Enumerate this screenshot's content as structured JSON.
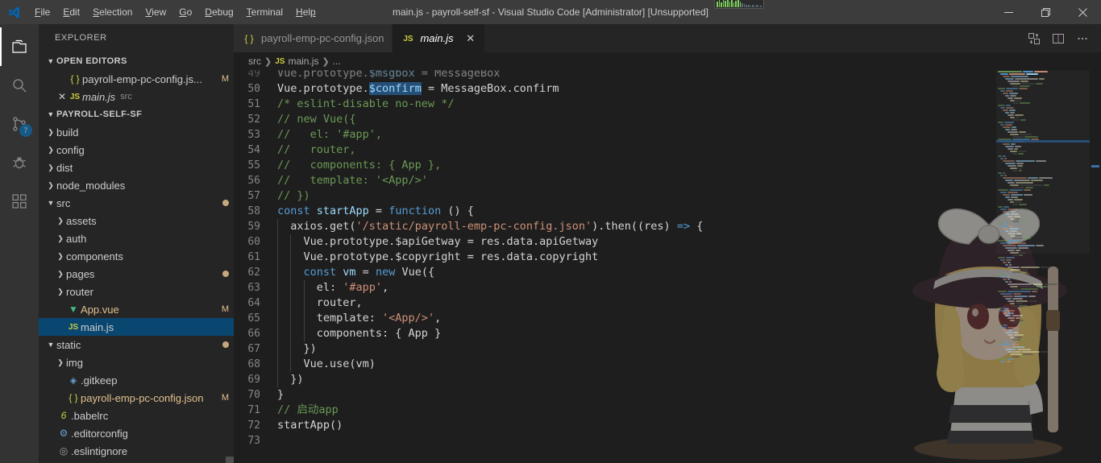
{
  "window": {
    "title": "main.js - payroll-self-sf - Visual Studio Code [Administrator] [Unsupported]",
    "logo_icon": "vscode-logo-icon",
    "minimize_icon": "minimize-icon",
    "restore_icon": "restore-icon",
    "close_icon": "close-icon"
  },
  "menu": {
    "items": [
      {
        "label": "File",
        "accel": "F"
      },
      {
        "label": "Edit",
        "accel": "E"
      },
      {
        "label": "Selection",
        "accel": "S"
      },
      {
        "label": "View",
        "accel": "V"
      },
      {
        "label": "Go",
        "accel": "G"
      },
      {
        "label": "Debug",
        "accel": "D"
      },
      {
        "label": "Terminal",
        "accel": "T"
      },
      {
        "label": "Help",
        "accel": "H"
      }
    ]
  },
  "activity_bar": {
    "items": [
      {
        "name": "explorer",
        "icon": "files-icon",
        "active": true,
        "badge": ""
      },
      {
        "name": "search",
        "icon": "search-icon",
        "active": false,
        "badge": ""
      },
      {
        "name": "source-control",
        "icon": "source-control-icon",
        "active": false,
        "badge": "7"
      },
      {
        "name": "debug",
        "icon": "debug-icon",
        "active": false,
        "badge": ""
      },
      {
        "name": "extensions",
        "icon": "extensions-icon",
        "active": false,
        "badge": ""
      }
    ]
  },
  "sidebar": {
    "title": "EXPLORER",
    "open_editors": {
      "header": "OPEN EDITORS",
      "items": [
        {
          "label": "payroll-emp-pc-config.js...",
          "icon": "json-file-icon",
          "badge": "M",
          "description": "",
          "close": false
        },
        {
          "label": "main.js",
          "icon": "js-file-icon",
          "badge": "",
          "description": "src",
          "close": true
        }
      ]
    },
    "project": {
      "header": "PAYROLL-SELF-SF",
      "items": [
        {
          "label": "build",
          "icon": "folder-icon",
          "indent": 1,
          "expanded": false,
          "badge": "",
          "dot": false,
          "selected": false
        },
        {
          "label": "config",
          "icon": "folder-icon",
          "indent": 1,
          "expanded": false,
          "badge": "",
          "dot": false,
          "selected": false
        },
        {
          "label": "dist",
          "icon": "folder-icon",
          "indent": 1,
          "expanded": false,
          "badge": "",
          "dot": false,
          "selected": false
        },
        {
          "label": "node_modules",
          "icon": "folder-icon",
          "indent": 1,
          "expanded": false,
          "badge": "",
          "dot": false,
          "selected": false
        },
        {
          "label": "src",
          "icon": "folder-icon",
          "indent": 1,
          "expanded": true,
          "badge": "",
          "dot": true,
          "selected": false
        },
        {
          "label": "assets",
          "icon": "folder-icon",
          "indent": 2,
          "expanded": false,
          "badge": "",
          "dot": false,
          "selected": false
        },
        {
          "label": "auth",
          "icon": "folder-icon",
          "indent": 2,
          "expanded": false,
          "badge": "",
          "dot": false,
          "selected": false
        },
        {
          "label": "components",
          "icon": "folder-icon",
          "indent": 2,
          "expanded": false,
          "badge": "",
          "dot": false,
          "selected": false
        },
        {
          "label": "pages",
          "icon": "folder-icon",
          "indent": 2,
          "expanded": false,
          "badge": "",
          "dot": true,
          "selected": false
        },
        {
          "label": "router",
          "icon": "folder-icon",
          "indent": 2,
          "expanded": false,
          "badge": "",
          "dot": false,
          "selected": false
        },
        {
          "label": "App.vue",
          "icon": "vue-file-icon",
          "indent": 2,
          "expanded": null,
          "badge": "M",
          "dot": false,
          "selected": false
        },
        {
          "label": "main.js",
          "icon": "js-file-icon",
          "indent": 2,
          "expanded": null,
          "badge": "",
          "dot": false,
          "selected": true
        },
        {
          "label": "static",
          "icon": "folder-icon",
          "indent": 1,
          "expanded": true,
          "badge": "",
          "dot": true,
          "selected": false
        },
        {
          "label": "img",
          "icon": "folder-icon",
          "indent": 2,
          "expanded": false,
          "badge": "",
          "dot": false,
          "selected": false
        },
        {
          "label": ".gitkeep",
          "icon": "gitkeep-file-icon",
          "indent": 2,
          "expanded": null,
          "badge": "",
          "dot": false,
          "selected": false
        },
        {
          "label": "payroll-emp-pc-config.json",
          "icon": "json-file-icon",
          "indent": 2,
          "expanded": null,
          "badge": "M",
          "dot": false,
          "selected": false
        },
        {
          "label": ".babelrc",
          "icon": "babel-file-icon",
          "indent": 1,
          "expanded": null,
          "badge": "",
          "dot": false,
          "selected": false
        },
        {
          "label": ".editorconfig",
          "icon": "gear-file-icon",
          "indent": 1,
          "expanded": null,
          "badge": "",
          "dot": false,
          "selected": false
        },
        {
          "label": ".eslintignore",
          "icon": "eslint-file-icon",
          "indent": 1,
          "expanded": null,
          "badge": "",
          "dot": false,
          "selected": false
        }
      ]
    }
  },
  "editor": {
    "tabs": [
      {
        "label": "payroll-emp-pc-config.json",
        "icon": "json-file-icon",
        "active": false,
        "closable": false
      },
      {
        "label": "main.js",
        "icon": "js-file-icon",
        "active": true,
        "closable": true
      }
    ],
    "tab_actions": [
      {
        "name": "split-compare-icon"
      },
      {
        "name": "split-editor-icon"
      },
      {
        "name": "more-actions-icon"
      }
    ],
    "breadcrumb": [
      {
        "label": "src",
        "icon": ""
      },
      {
        "label": "main.js",
        "icon": "js-file-icon"
      },
      {
        "label": "...",
        "icon": ""
      }
    ],
    "first_line_number": 49,
    "lines": [
      {
        "n": 49,
        "clipped": true,
        "indent": 0,
        "tokens": [
          {
            "t": "Vue.prototype.",
            "c": "t-def"
          },
          {
            "t": "$msgbox",
            "c": "t-var"
          },
          {
            "t": " = ",
            "c": "t-op"
          },
          {
            "t": "MessageBox",
            "c": "t-def"
          }
        ]
      },
      {
        "n": 50,
        "clipped": false,
        "indent": 0,
        "tokens": [
          {
            "t": "Vue.prototype.",
            "c": "t-def"
          },
          {
            "t": "$confirm",
            "c": "t-var word-hl"
          },
          {
            "t": " = ",
            "c": "t-op"
          },
          {
            "t": "MessageBox.confirm",
            "c": "t-def"
          }
        ]
      },
      {
        "n": 51,
        "clipped": false,
        "indent": 0,
        "tokens": [
          {
            "t": "/* eslint-disable no-new */",
            "c": "t-com"
          }
        ]
      },
      {
        "n": 52,
        "clipped": false,
        "indent": 0,
        "tokens": [
          {
            "t": "// new Vue({",
            "c": "t-com"
          }
        ]
      },
      {
        "n": 53,
        "clipped": false,
        "indent": 0,
        "tokens": [
          {
            "t": "//   el: '#app',",
            "c": "t-com"
          }
        ]
      },
      {
        "n": 54,
        "clipped": false,
        "indent": 0,
        "tokens": [
          {
            "t": "//   router,",
            "c": "t-com"
          }
        ]
      },
      {
        "n": 55,
        "clipped": false,
        "indent": 0,
        "tokens": [
          {
            "t": "//   components: { App },",
            "c": "t-com"
          }
        ]
      },
      {
        "n": 56,
        "clipped": false,
        "indent": 0,
        "tokens": [
          {
            "t": "//   template: '<App/>'",
            "c": "t-com"
          }
        ]
      },
      {
        "n": 57,
        "clipped": false,
        "indent": 0,
        "tokens": [
          {
            "t": "// })",
            "c": "t-com"
          }
        ]
      },
      {
        "n": 58,
        "clipped": false,
        "indent": 0,
        "tokens": [
          {
            "t": "const",
            "c": "t-kw"
          },
          {
            "t": " startApp ",
            "c": "t-var"
          },
          {
            "t": "= ",
            "c": "t-op"
          },
          {
            "t": "function",
            "c": "t-kw"
          },
          {
            "t": " () {",
            "c": "t-def"
          }
        ]
      },
      {
        "n": 59,
        "clipped": false,
        "indent": 1,
        "tokens": [
          {
            "t": "  axios.get(",
            "c": "t-def"
          },
          {
            "t": "'/static/payroll-emp-pc-config.json'",
            "c": "t-str"
          },
          {
            "t": ").then((res) ",
            "c": "t-def"
          },
          {
            "t": "=>",
            "c": "t-kw"
          },
          {
            "t": " {",
            "c": "t-def"
          }
        ]
      },
      {
        "n": 60,
        "clipped": false,
        "indent": 2,
        "tokens": [
          {
            "t": "    Vue.prototype.$apiGetway = res.data.apiGetway",
            "c": "t-def"
          }
        ]
      },
      {
        "n": 61,
        "clipped": false,
        "indent": 2,
        "tokens": [
          {
            "t": "    Vue.prototype.$copyright = res.data.copyright",
            "c": "t-def"
          }
        ]
      },
      {
        "n": 62,
        "clipped": false,
        "indent": 2,
        "tokens": [
          {
            "t": "    ",
            "c": "t-def"
          },
          {
            "t": "const",
            "c": "t-kw"
          },
          {
            "t": " vm ",
            "c": "t-var"
          },
          {
            "t": "= ",
            "c": "t-op"
          },
          {
            "t": "new",
            "c": "t-kw"
          },
          {
            "t": " Vue({",
            "c": "t-def"
          }
        ]
      },
      {
        "n": 63,
        "clipped": false,
        "indent": 3,
        "tokens": [
          {
            "t": "      el: ",
            "c": "t-def"
          },
          {
            "t": "'#app'",
            "c": "t-str"
          },
          {
            "t": ",",
            "c": "t-def"
          }
        ]
      },
      {
        "n": 64,
        "clipped": false,
        "indent": 3,
        "tokens": [
          {
            "t": "      router,",
            "c": "t-def"
          }
        ]
      },
      {
        "n": 65,
        "clipped": false,
        "indent": 3,
        "tokens": [
          {
            "t": "      template: ",
            "c": "t-def"
          },
          {
            "t": "'<App/>'",
            "c": "t-str"
          },
          {
            "t": ",",
            "c": "t-def"
          }
        ]
      },
      {
        "n": 66,
        "clipped": false,
        "indent": 3,
        "tokens": [
          {
            "t": "      components: { App }",
            "c": "t-def"
          }
        ]
      },
      {
        "n": 67,
        "clipped": false,
        "indent": 2,
        "tokens": [
          {
            "t": "    })",
            "c": "t-def"
          }
        ]
      },
      {
        "n": 68,
        "clipped": false,
        "indent": 2,
        "tokens": [
          {
            "t": "    Vue.use(vm)",
            "c": "t-def"
          }
        ]
      },
      {
        "n": 69,
        "clipped": false,
        "indent": 1,
        "tokens": [
          {
            "t": "  })",
            "c": "t-def"
          }
        ]
      },
      {
        "n": 70,
        "clipped": false,
        "indent": 0,
        "tokens": [
          {
            "t": "}",
            "c": "t-def"
          }
        ]
      },
      {
        "n": 71,
        "clipped": false,
        "indent": 0,
        "tokens": [
          {
            "t": "// 启动app",
            "c": "t-com"
          }
        ]
      },
      {
        "n": 72,
        "clipped": false,
        "indent": 0,
        "tokens": [
          {
            "t": "startApp()",
            "c": "t-def"
          }
        ]
      },
      {
        "n": 73,
        "clipped": false,
        "indent": 0,
        "tokens": []
      }
    ]
  },
  "colors": {
    "titlebar_bg": "#3c3c3c",
    "activitybar_bg": "#333333",
    "sidebar_bg": "#252526",
    "editor_bg": "#1e1e1e",
    "selection_blue": "#094771",
    "accent_blue": "#007acc",
    "badge_orange": "#e2c08d",
    "comment_green": "#6a9955",
    "string_orange": "#ce9178",
    "keyword_blue": "#569cd6",
    "word_highlight": "#264f78"
  }
}
